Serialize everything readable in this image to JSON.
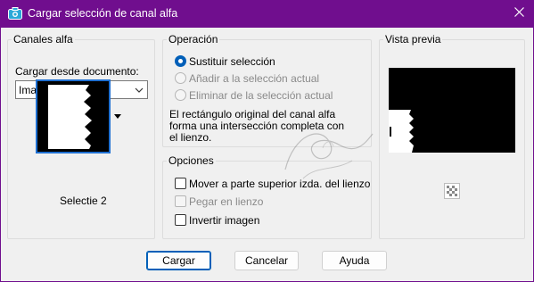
{
  "window": {
    "title": "Cargar selección de canal alfa",
    "title_icon": "camera-icon",
    "close_icon": "close-icon",
    "titlebar_color": "#700e8e"
  },
  "canales": {
    "group_title": "Canales alfa",
    "load_from_label": "Cargar desde documento:",
    "document_select_value": "Imagen2",
    "thumbnail_caption": "Selectie 2"
  },
  "operacion": {
    "group_title": "Operación",
    "options": [
      {
        "label": "Sustituir selección",
        "checked": true,
        "enabled": true
      },
      {
        "label": "Añadir a la selección actual",
        "checked": false,
        "enabled": false
      },
      {
        "label": "Eliminar de la selección actual",
        "checked": false,
        "enabled": false
      }
    ],
    "description": [
      "El rectángulo original del canal alfa",
      "forma una intersección completa con",
      "el lienzo."
    ]
  },
  "opciones": {
    "group_title": "Opciones",
    "checks": [
      {
        "label": "Mover a parte superior izda. del lienzo",
        "checked": false,
        "enabled": true
      },
      {
        "label": "Pegar en lienzo",
        "checked": false,
        "enabled": false
      },
      {
        "label": "Invertir imagen",
        "checked": false,
        "enabled": true
      }
    ]
  },
  "vista_previa": {
    "group_title": "Vista previa",
    "zoom_icon": "checker-zoom-icon"
  },
  "buttons": {
    "load": "Cargar",
    "cancel": "Cancelar",
    "help": "Ayuda"
  },
  "colors": {
    "accent": "#005fb8",
    "thumbnail_border": "#1e6fd1"
  }
}
